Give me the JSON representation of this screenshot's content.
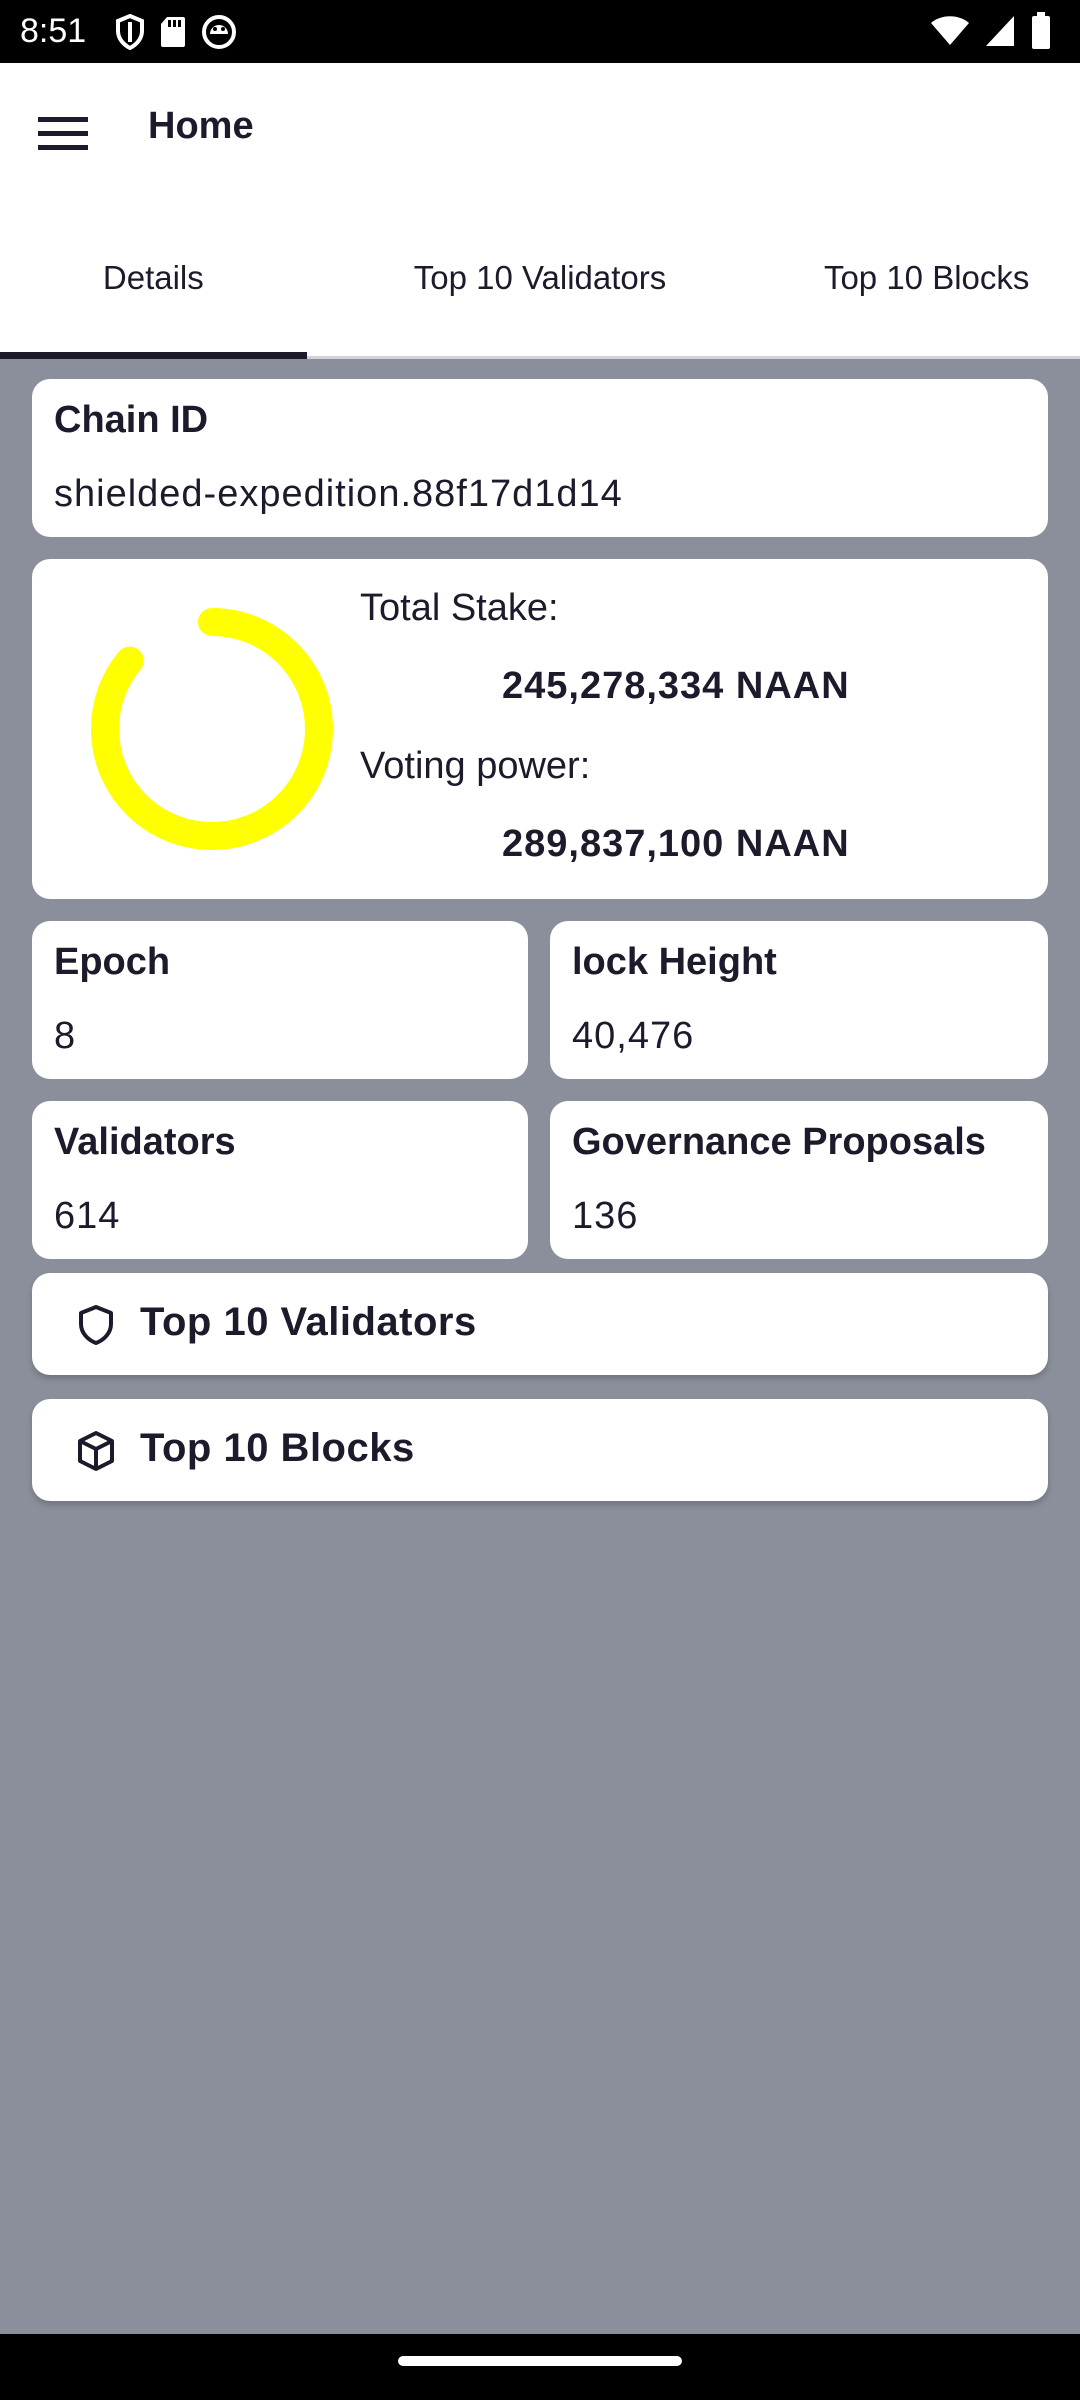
{
  "status_bar": {
    "time": "8:51",
    "left_icons": [
      "shield-icon",
      "sd-card-icon",
      "app-notification-icon"
    ],
    "right_icons": [
      "wifi-icon",
      "cell-signal-icon",
      "battery-icon"
    ]
  },
  "app_bar": {
    "title": "Home",
    "menu_icon": "hamburger-menu-icon"
  },
  "tabs": [
    {
      "label": "Details",
      "active": true
    },
    {
      "label": "Top 10 Validators",
      "active": false
    },
    {
      "label": "Top 10 Blocks",
      "active": false
    }
  ],
  "chain": {
    "label": "Chain ID",
    "value": "shielded-expedition.88f17d1d14"
  },
  "stake": {
    "ring_color": "#ffff00",
    "total_label": "Total Stake:",
    "total_value": "245,278,334 NAAN",
    "voting_label": "Voting power:",
    "voting_value": "289,837,100 NAAN",
    "ring_fraction": 0.86
  },
  "stats": [
    {
      "label": "Epoch",
      "value": "8"
    },
    {
      "label": "lock Height",
      "value": "40,476"
    },
    {
      "label": "Validators",
      "value": "614"
    },
    {
      "label": "Governance Proposals",
      "value": "136"
    }
  ],
  "links": [
    {
      "label": "Top 10 Validators",
      "icon": "shield-icon"
    },
    {
      "label": "Top 10 Blocks",
      "icon": "cube-icon"
    }
  ],
  "colors": {
    "background": "#8a8f9b",
    "text": "#1d1b2b",
    "accent": "#ffff00"
  }
}
